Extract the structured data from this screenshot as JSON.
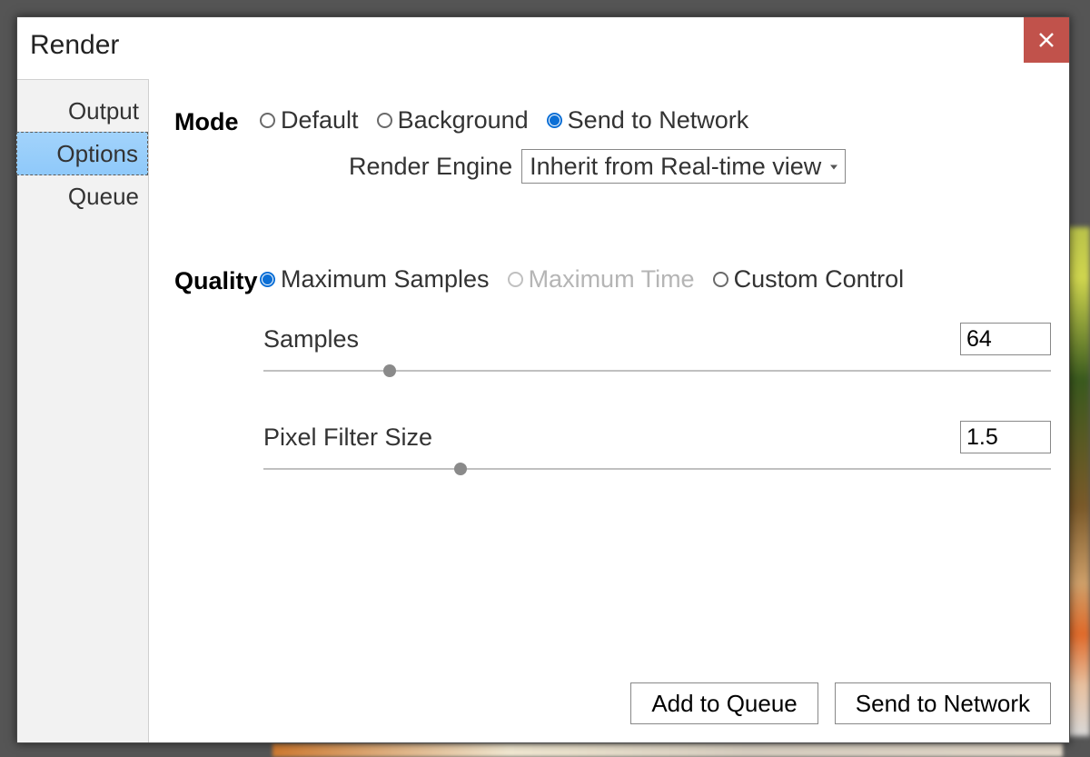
{
  "dialog": {
    "title": "Render",
    "close_glyph": "×"
  },
  "sidebar": {
    "tabs": [
      {
        "label": "Output",
        "selected": false
      },
      {
        "label": "Options",
        "selected": true
      },
      {
        "label": "Queue",
        "selected": false
      }
    ]
  },
  "mode": {
    "label": "Mode",
    "options": [
      {
        "label": "Default",
        "selected": false,
        "disabled": false
      },
      {
        "label": "Background",
        "selected": false,
        "disabled": false
      },
      {
        "label": "Send to Network",
        "selected": true,
        "disabled": false
      }
    ],
    "engine_label": "Render Engine",
    "engine_value": "Inherit from Real-time view"
  },
  "quality": {
    "label": "Quality",
    "options": [
      {
        "label": "Maximum Samples",
        "selected": true,
        "disabled": false
      },
      {
        "label": "Maximum Time",
        "selected": false,
        "disabled": true
      },
      {
        "label": "Custom Control",
        "selected": false,
        "disabled": false
      }
    ],
    "samples": {
      "label": "Samples",
      "value": "64",
      "thumb_percent": 16
    },
    "pixel_filter": {
      "label": "Pixel Filter Size",
      "value": "1.5",
      "thumb_percent": 25
    }
  },
  "footer": {
    "add_to_queue": "Add to Queue",
    "send_to_network": "Send to Network"
  }
}
